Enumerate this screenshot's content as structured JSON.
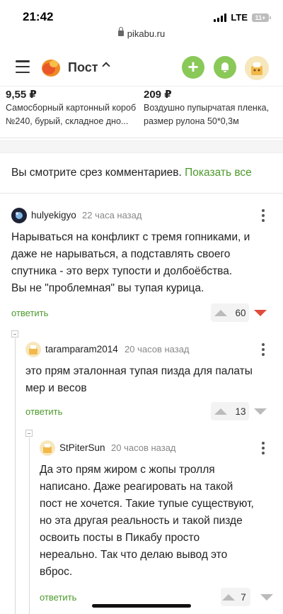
{
  "status_bar": {
    "time": "21:42",
    "network": "LTE",
    "battery": "11+"
  },
  "url_bar": {
    "domain": "pikabu.ru",
    "lock_icon": "lock-icon"
  },
  "header": {
    "title": "Пост",
    "icons": {
      "menu": "hamburger-menu-icon",
      "logo": "pikabu-logo-icon",
      "chevron": "chevron-up-icon",
      "add": "plus-icon",
      "notifications": "bell-icon",
      "avatar": "user-avatar"
    },
    "add_label": "+",
    "accent_color": "#8ac858"
  },
  "products": [
    {
      "price": "9,55 ₽",
      "name_line1": "Самосборный картонный короб",
      "name_line2": "№240, бурый, складное дно..."
    },
    {
      "price": "209 ₽",
      "name_line1": "Воздушно пупырчатая пленка,",
      "name_line2": "размер рулона 50*0,3м"
    }
  ],
  "notice": {
    "text": "Вы смотрите срез комментариев.",
    "link": "Показать все"
  },
  "comments": [
    {
      "author": "hulyekigyo",
      "time": "22 часа назад",
      "lines": [
        "Нарываться на конфликт с тремя гопниками, и",
        "даже не нарываться, а подставлять своего",
        "спутника - это верх тупости и долбоёбства.",
        "Вы не \"проблемная\" вы тупая курица."
      ],
      "reply_label": "ответить",
      "rating": "60",
      "downvoted": true
    },
    {
      "author": "taramparam2014",
      "time": "20 часов назад",
      "lines": [
        "это прям эталонная тупая пизда для палаты",
        "мер и весов"
      ],
      "reply_label": "ответить",
      "rating": "13",
      "downvoted": false
    },
    {
      "author": "StPiterSun",
      "time": "20 часов назад",
      "lines": [
        "Да это прям жиром с жопы тролля",
        "написано. Даже реагировать на такой",
        "пост не хочется. Такие тупые существуют,",
        "но эта другая реальность и такой пизде",
        "освоить посты в Пикабу просто",
        "нереально. Так что делаю вывод это",
        "вброс."
      ],
      "reply_label": "ответить",
      "rating": "7",
      "downvoted": false
    }
  ],
  "colors": {
    "link_green": "#4b9a2b",
    "downvote_red": "#e04b3a"
  }
}
